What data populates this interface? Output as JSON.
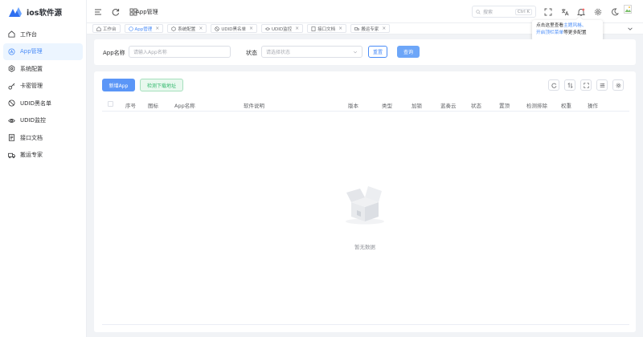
{
  "app": {
    "name": "ios软件源",
    "accent": "#4a8cf7"
  },
  "sidebar": {
    "items": [
      {
        "label": "工作台",
        "icon": "home-icon",
        "active": false
      },
      {
        "label": "App管理",
        "icon": "app-icon",
        "active": true
      },
      {
        "label": "系统配置",
        "icon": "gear-icon",
        "active": false
      },
      {
        "label": "卡密管理",
        "icon": "key-icon",
        "active": false
      },
      {
        "label": "UDID黑名单",
        "icon": "ban-icon",
        "active": false
      },
      {
        "label": "UDID监控",
        "icon": "eye-icon",
        "active": false
      },
      {
        "label": "接口文档",
        "icon": "document-icon",
        "active": false
      },
      {
        "label": "搬运专家",
        "icon": "truck-icon",
        "active": false
      }
    ]
  },
  "header": {
    "breadcrumb": "App管理",
    "search_placeholder": "搜索",
    "search_shortcut": "Ctrl K"
  },
  "tabs": [
    {
      "label": "工作台",
      "icon": "home-icon",
      "closable": false,
      "active": false
    },
    {
      "label": "App管理",
      "icon": "app-icon",
      "closable": true,
      "active": true
    },
    {
      "label": "系统配置",
      "icon": "gear-icon",
      "closable": true,
      "active": false
    },
    {
      "label": "UDID黑名单",
      "icon": "ban-icon",
      "closable": true,
      "active": false
    },
    {
      "label": "UDID监控",
      "icon": "eye-icon",
      "closable": true,
      "active": false
    },
    {
      "label": "接口文档",
      "icon": "document-icon",
      "closable": true,
      "active": false
    },
    {
      "label": "搬运专家",
      "icon": "truck-icon",
      "closable": true,
      "active": false
    }
  ],
  "tooltip": {
    "prefix": "点击这里查看",
    "link1": "主题风格、",
    "link2": "开启顶栏菜单",
    "suffix": "等更多配置"
  },
  "search_form": {
    "app_name_label": "App名称",
    "app_name_placeholder": "请输入App名称",
    "status_label": "状态",
    "status_placeholder": "请选择状态",
    "reset_label": "重置",
    "query_label": "查询"
  },
  "table": {
    "new_button": "新增App",
    "detect_button": "检测下载地址",
    "columns": [
      "序号",
      "图标",
      "App名称",
      "软件说明",
      "版本",
      "类型",
      "加锁",
      "蓝奏云",
      "状态",
      "置顶",
      "检测排除",
      "权重",
      "操作"
    ],
    "empty_text": "暂无数据"
  }
}
